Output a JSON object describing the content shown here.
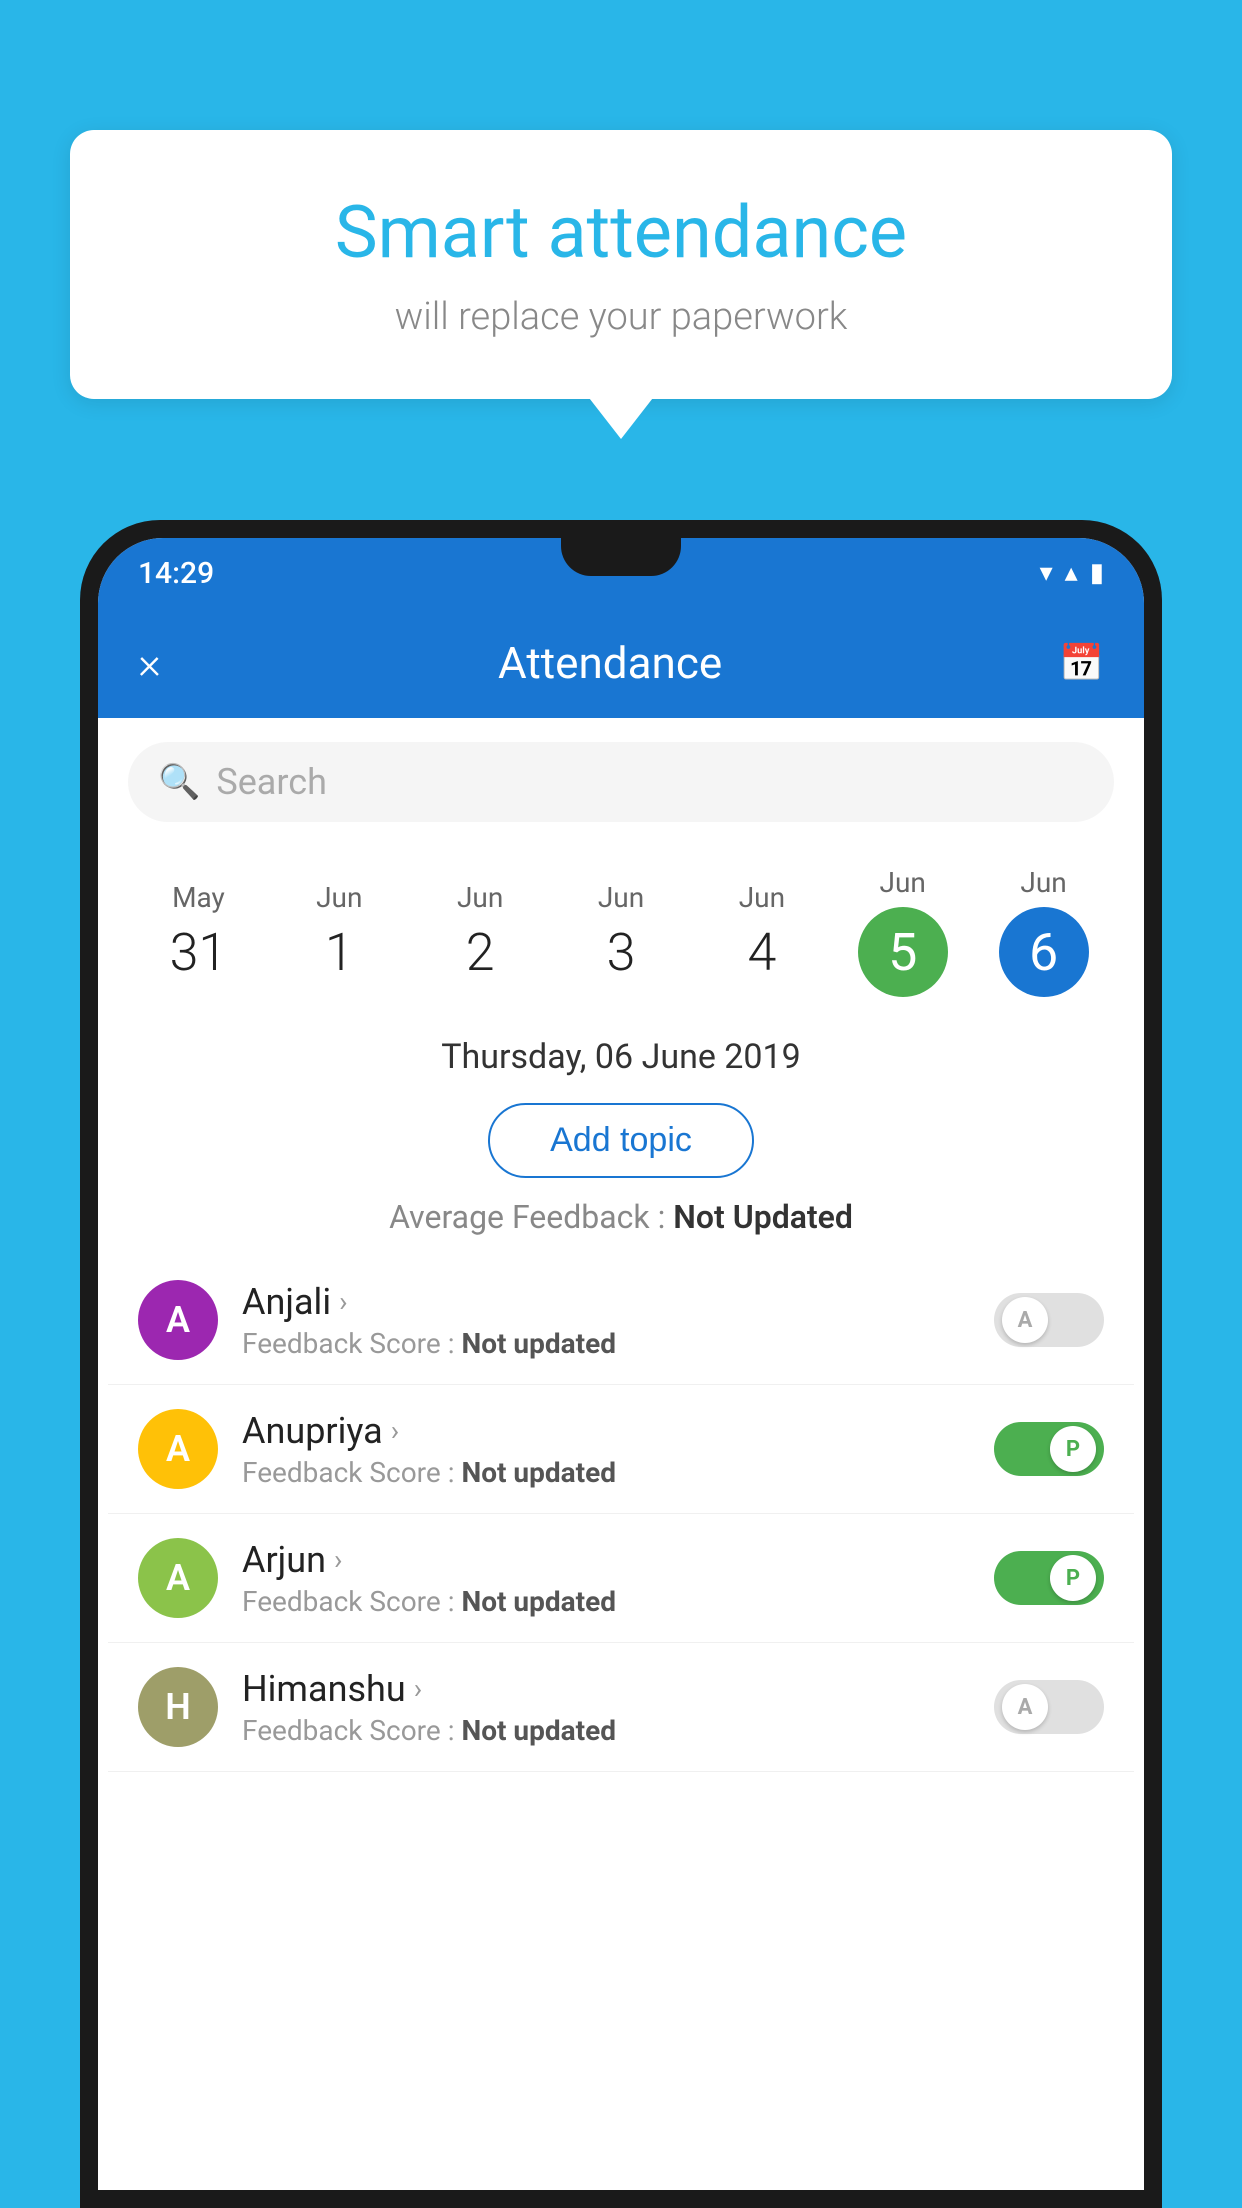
{
  "background_color": "#29b6e8",
  "speech_bubble": {
    "title": "Smart attendance",
    "subtitle": "will replace your paperwork"
  },
  "status_bar": {
    "time": "14:29",
    "wifi_icon": "▼",
    "signal_icon": "▲",
    "battery_icon": "▮"
  },
  "app_header": {
    "close_label": "×",
    "title": "Attendance",
    "calendar_icon": "📅"
  },
  "search": {
    "placeholder": "Search"
  },
  "date_picker": {
    "dates": [
      {
        "month": "May",
        "day": "31",
        "selected": false
      },
      {
        "month": "Jun",
        "day": "1",
        "selected": false
      },
      {
        "month": "Jun",
        "day": "2",
        "selected": false
      },
      {
        "month": "Jun",
        "day": "3",
        "selected": false
      },
      {
        "month": "Jun",
        "day": "4",
        "selected": false
      },
      {
        "month": "Jun",
        "day": "5",
        "selected": "green"
      },
      {
        "month": "Jun",
        "day": "6",
        "selected": "blue"
      }
    ]
  },
  "selected_date_label": "Thursday, 06 June 2019",
  "add_topic_button": "Add topic",
  "average_feedback_label": "Average Feedback :",
  "average_feedback_value": "Not Updated",
  "students": [
    {
      "name": "Anjali",
      "avatar_letter": "A",
      "avatar_color": "purple",
      "feedback_label": "Feedback Score :",
      "feedback_value": "Not updated",
      "attendance": "off",
      "toggle_label": "A"
    },
    {
      "name": "Anupriya",
      "avatar_letter": "A",
      "avatar_color": "yellow",
      "feedback_label": "Feedback Score :",
      "feedback_value": "Not updated",
      "attendance": "on",
      "toggle_label": "P"
    },
    {
      "name": "Arjun",
      "avatar_letter": "A",
      "avatar_color": "green",
      "feedback_label": "Feedback Score :",
      "feedback_value": "Not updated",
      "attendance": "on",
      "toggle_label": "P"
    },
    {
      "name": "Himanshu",
      "avatar_letter": "H",
      "avatar_color": "olive",
      "feedback_label": "Feedback Score :",
      "feedback_value": "Not updated",
      "attendance": "off",
      "toggle_label": "A"
    }
  ]
}
